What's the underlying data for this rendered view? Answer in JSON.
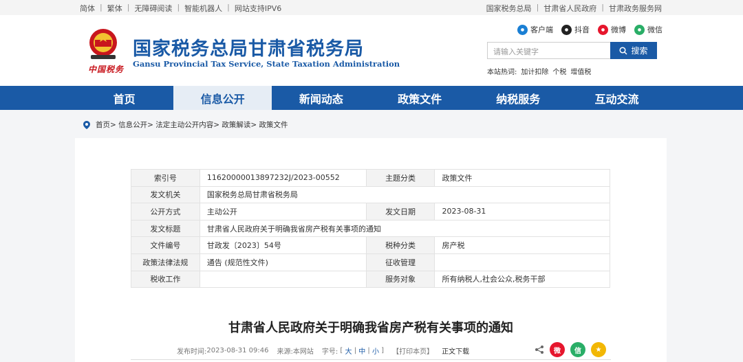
{
  "topbar": {
    "left": [
      "简体",
      "繁体",
      "无障碍阅读",
      "智能机器人",
      "网站支持IPV6"
    ],
    "right": [
      "国家税务总局",
      "甘肃省人民政府",
      "甘肃政务服务网"
    ]
  },
  "header": {
    "title_cn": "国家税务总局甘肃省税务局",
    "title_en": "Gansu Provincial Tax Service, State Taxation Administration",
    "seal_text": "中国税务",
    "social": [
      {
        "label": "客户端",
        "icon": "app-icon",
        "color": "#1a7fd4"
      },
      {
        "label": "抖音",
        "icon": "douyin-icon",
        "color": "#222222"
      },
      {
        "label": "微博",
        "icon": "weibo-icon",
        "color": "#e6162d"
      },
      {
        "label": "微信",
        "icon": "wechat-icon",
        "color": "#2aae67"
      }
    ],
    "search": {
      "placeholder": "请输入关键字",
      "button": "搜索"
    },
    "hotwords_label": "本站热词:",
    "hotwords": [
      "加计扣除",
      "个税",
      "增值税"
    ]
  },
  "nav": {
    "items": [
      "首页",
      "信息公开",
      "新闻动态",
      "政策文件",
      "纳税服务",
      "互动交流"
    ],
    "active_index": 1
  },
  "breadcrumb": "首页> 信息公开> 法定主动公开内容> 政策解读> 政策文件",
  "meta": {
    "rows": [
      {
        "k1": "索引号",
        "v1": "11620000013897232J/2023-00552",
        "k2": "主题分类",
        "v2": "政策文件"
      },
      {
        "k1": "发文机关",
        "v1": "国家税务总局甘肃省税务局"
      },
      {
        "k1": "公开方式",
        "v1": "主动公开",
        "k2": "发文日期",
        "v2": "2023-08-31"
      },
      {
        "k1": "发文标题",
        "v1": "甘肃省人民政府关于明确我省房产税有关事项的通知"
      },
      {
        "k1": "文件编号",
        "v1": "甘政发〔2023〕54号",
        "k2": "税种分类",
        "v2": "房产税"
      },
      {
        "k1": "政策法律法规",
        "v1": "通告 (规范性文件)",
        "k2": "征收管理",
        "v2": ""
      },
      {
        "k1": "税收工作",
        "v1": "",
        "k2": "服务对象",
        "v2": "所有纳税人,社会公众,税务干部"
      }
    ]
  },
  "article": {
    "title": "甘肃省人民政府关于明确我省房产税有关事项的通知",
    "publish_label": "发布时间:",
    "publish_time": "2023-08-31 09:46",
    "source_label": "来源:",
    "source": "本网站",
    "font_label": "字号:",
    "font_large": "大",
    "font_medium": "中",
    "font_small": "小",
    "print": "【打印本页】",
    "download": "正文下载"
  },
  "share": [
    {
      "name": "share-weibo-icon",
      "color": "#e6162d",
      "glyph": "微"
    },
    {
      "name": "share-wechat-icon",
      "color": "#2aae67",
      "glyph": "信"
    },
    {
      "name": "share-favorite-icon",
      "color": "#f2b705",
      "glyph": "★"
    }
  ]
}
